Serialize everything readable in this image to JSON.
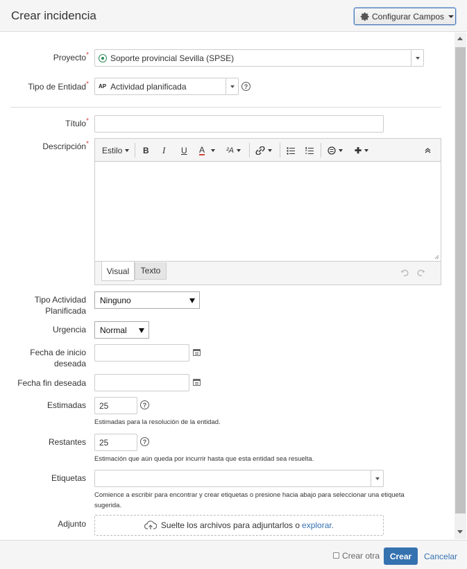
{
  "header": {
    "title": "Crear incidencia",
    "configure_button": "Configurar Campos"
  },
  "fields": {
    "project": {
      "label": "Proyecto",
      "required_mark": "*",
      "value": "Soporte provincial Sevilla (SPSE)"
    },
    "entity_type": {
      "label": "Tipo de Entidad",
      "required_mark": "*",
      "badge": "AP",
      "value": "Actividad planificada",
      "help": "?"
    },
    "title": {
      "label": "Título",
      "required_mark": "*",
      "value": ""
    },
    "description": {
      "label": "Descripción",
      "required_mark": "*",
      "toolbar": {
        "style": "Estilo",
        "bold": "B",
        "italic": "I",
        "underline": "U",
        "text_color": "A",
        "text_size": "²A",
        "plus": "✚"
      },
      "tabs": [
        "Visual",
        "Texto"
      ],
      "active_tab": "Visual"
    },
    "activity_type": {
      "label_line1": "Tipo Actividad",
      "label_line2": "Planificada",
      "value": "Ninguno"
    },
    "urgency": {
      "label": "Urgencia",
      "value": "Normal"
    },
    "start_date": {
      "label_line1": "Fecha de inicio",
      "label_line2": "deseada",
      "value": ""
    },
    "end_date": {
      "label": "Fecha fin deseada",
      "value": ""
    },
    "estimated": {
      "label": "Estimadas",
      "value": "25",
      "help": "?",
      "hint": "Estimadas para la resolución de la entidad."
    },
    "remaining": {
      "label": "Restantes",
      "value": "25",
      "help": "?",
      "hint": "Estimación que aún queda por incurrir hasta que esta entidad sea resuelta."
    },
    "labels": {
      "label": "Etiquetas",
      "value": "",
      "hint_line1": "Comience a escribir para encontrar y crear etiquetas o presione hacia abajo para seleccionar una etiqueta",
      "hint_line2": "sugerida."
    },
    "attachment": {
      "label": "Adjunto",
      "drop_text": "Suelte los archivos para adjuntarlos o",
      "browse_link": "explorar."
    }
  },
  "footer": {
    "create_another": "Crear otra",
    "create_button": "Crear",
    "cancel_link": "Cancelar"
  },
  "colors": {
    "primary": "#3572b0",
    "required": "#d04437",
    "project_icon": "#2e8b57"
  }
}
